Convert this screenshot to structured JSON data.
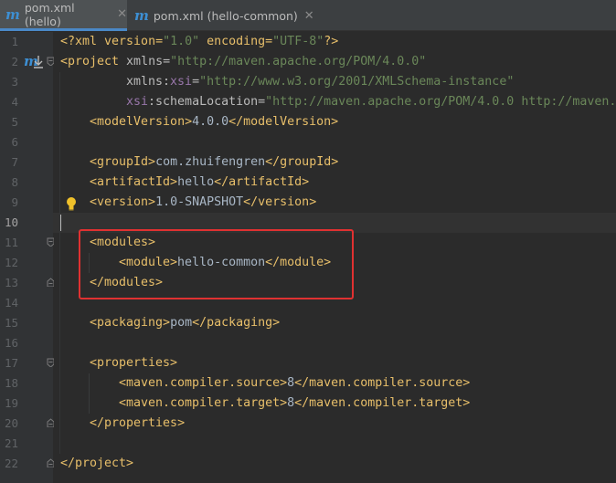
{
  "tabs": [
    {
      "icon": "maven-icon",
      "label": "pom.xml (hello)",
      "active": true
    },
    {
      "icon": "maven-icon",
      "label": "pom.xml (hello-common)",
      "active": false
    }
  ],
  "line_numbers": [
    "1",
    "2",
    "3",
    "4",
    "5",
    "6",
    "7",
    "8",
    "9",
    "10",
    "11",
    "12",
    "13",
    "14",
    "15",
    "16",
    "17",
    "18",
    "19",
    "20",
    "21",
    "22"
  ],
  "code": {
    "l1": {
      "a": "<?xml version=",
      "b": "\"1.0\"",
      "c": " encoding=",
      "d": "\"UTF-8\"",
      "e": "?>"
    },
    "l2": {
      "a": "<project",
      "b": " xmlns=",
      "c": "\"http://maven.apache.org/POM/4.0.0\""
    },
    "l3": {
      "a": "xmlns:",
      "b": "xsi",
      "c": "=",
      "d": "\"http://www.w3.org/2001/XMLSchema-instance\""
    },
    "l4": {
      "a": "xsi",
      "b": ":schemaLocation=",
      "c": "\"http://maven.apache.org/POM/4.0.0 http://maven."
    },
    "l5": {
      "open": "<modelVersion>",
      "text": "4.0.0",
      "close": "</modelVersion>"
    },
    "l7": {
      "open": "<groupId>",
      "text": "com.zhuifengren",
      "close": "</groupId>"
    },
    "l8": {
      "open": "<artifactId>",
      "text": "hello",
      "close": "</artifactId>"
    },
    "l9": {
      "open": "<version>",
      "text": "1.0-SNAPSHOT",
      "close": "</version>"
    },
    "l11": {
      "open": "<modules>"
    },
    "l12": {
      "open": "<module>",
      "text": "hello-common",
      "close": "</module>"
    },
    "l13": {
      "close": "</modules>"
    },
    "l15": {
      "open": "<packaging>",
      "text": "pom",
      "close": "</packaging>"
    },
    "l17": {
      "open": "<properties>"
    },
    "l18": {
      "open": "<maven.compiler.source>",
      "text": "8",
      "close": "</maven.compiler.source>"
    },
    "l19": {
      "open": "<maven.compiler.target>",
      "text": "8",
      "close": "</maven.compiler.target>"
    },
    "l20": {
      "close": "</properties>"
    },
    "l22": {
      "close": "</project>"
    }
  },
  "current_line": "10",
  "colors": {
    "tag": "#e8bf6a",
    "string": "#6a8759",
    "namespace": "#9876aa",
    "highlight_box": "#e03131",
    "line_number": "#606366"
  }
}
